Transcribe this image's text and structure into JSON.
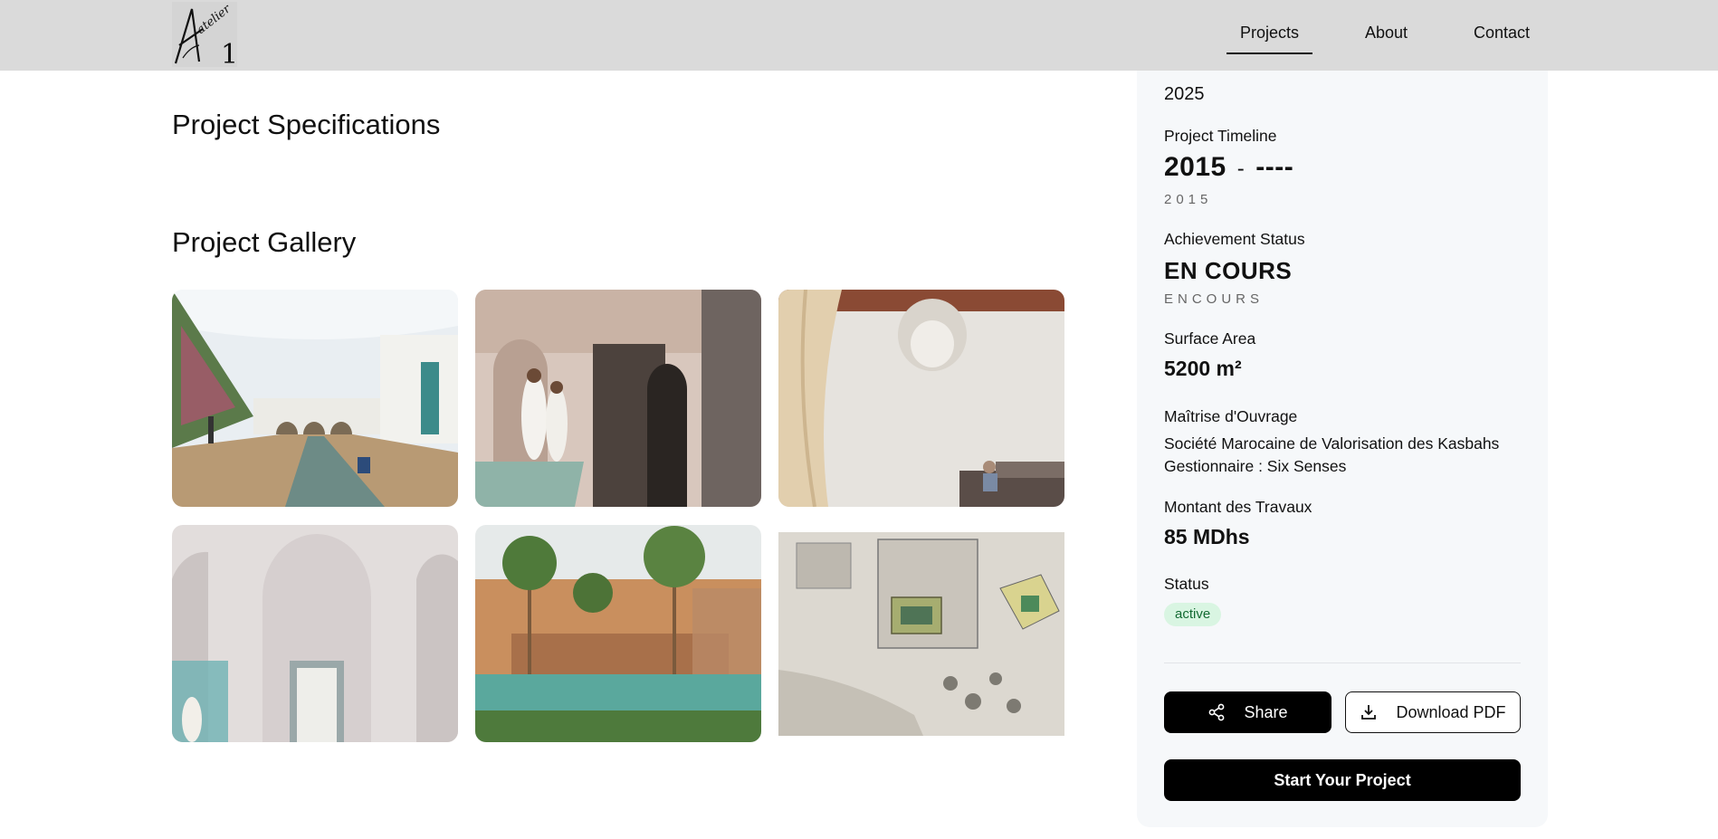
{
  "header": {
    "logo_text": "Atelier 1",
    "nav": [
      {
        "label": "Projects",
        "active": true
      },
      {
        "label": "About",
        "active": false
      },
      {
        "label": "Contact",
        "active": false
      }
    ]
  },
  "main": {
    "specs_heading": "Project Specifications",
    "gallery_heading": "Project Gallery",
    "gallery": [
      {
        "subject": "courtyard-pool-interior"
      },
      {
        "subject": "hammam-bathrobes"
      },
      {
        "subject": "chandelier-lounge"
      },
      {
        "subject": "white-arches"
      },
      {
        "subject": "palm-pool-courtyard"
      },
      {
        "subject": "site-plan"
      }
    ]
  },
  "sidebar": {
    "year": "2025",
    "timeline": {
      "label": "Project Timeline",
      "start": "2015",
      "dash": "-",
      "end": "----",
      "sub": "2015"
    },
    "achievement": {
      "label": "Achievement Status",
      "value": "EN COURS",
      "sub": "ENCOURS"
    },
    "surface": {
      "label": "Surface Area",
      "value": "5200 m²"
    },
    "maitrise": {
      "label": "Maîtrise d'Ouvrage",
      "line1": "Société Marocaine de Valorisation des Kasbahs",
      "line2": "Gestionnaire : Six Senses"
    },
    "montant": {
      "label": "Montant des Travaux",
      "value": "85 MDhs"
    },
    "status": {
      "label": "Status",
      "badge": "active"
    },
    "buttons": {
      "share": "Share",
      "download": "Download PDF",
      "start": "Start Your Project"
    }
  },
  "colors": {
    "header_bg": "#dadada",
    "sidebar_bg": "#f6f8fa",
    "badge_bg": "#d9f5e2",
    "badge_text": "#146b33",
    "primary": "#000000"
  }
}
